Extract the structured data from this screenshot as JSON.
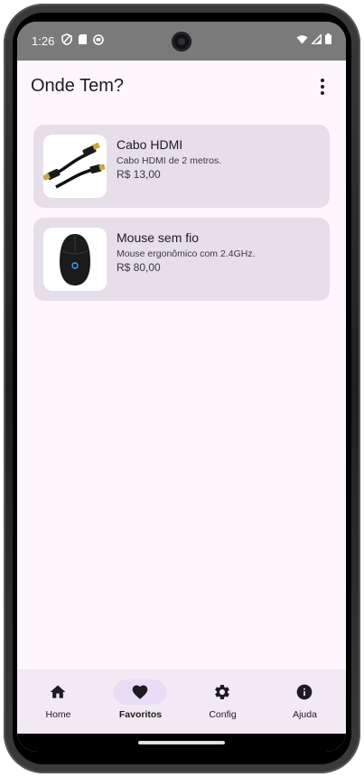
{
  "status_bar": {
    "time": "1:26",
    "left_icons": [
      "shield-icon",
      "sd-card-icon",
      "app-status-icon"
    ],
    "right_icons": [
      "wifi-icon",
      "signal-icon",
      "battery-icon"
    ]
  },
  "app_bar": {
    "title": "Onde Tem?",
    "menu_icon": "more-vert-icon"
  },
  "products": [
    {
      "title": "Cabo HDMI",
      "description": "Cabo HDMI de 2 metros.",
      "price": "R$ 13,00",
      "image": "hdmi-cable-image"
    },
    {
      "title": "Mouse sem fio",
      "description": "Mouse ergonômico com 2.4GHz.",
      "price": "R$ 80,00",
      "image": "wireless-mouse-image"
    }
  ],
  "bottom_nav": {
    "items": [
      {
        "label": "Home",
        "icon": "home-icon",
        "active": false
      },
      {
        "label": "Favoritos",
        "icon": "heart-icon",
        "active": true
      },
      {
        "label": "Config",
        "icon": "gear-icon",
        "active": false
      },
      {
        "label": "Ajuda",
        "icon": "info-icon",
        "active": false
      }
    ]
  },
  "colors": {
    "background": "#fdf6fd",
    "card": "#e6dfe9",
    "status_bar": "#7a7a7a",
    "nav_bar": "#f1e9f3",
    "active_pill": "#e8ddf7",
    "text": "#1d1b20"
  }
}
